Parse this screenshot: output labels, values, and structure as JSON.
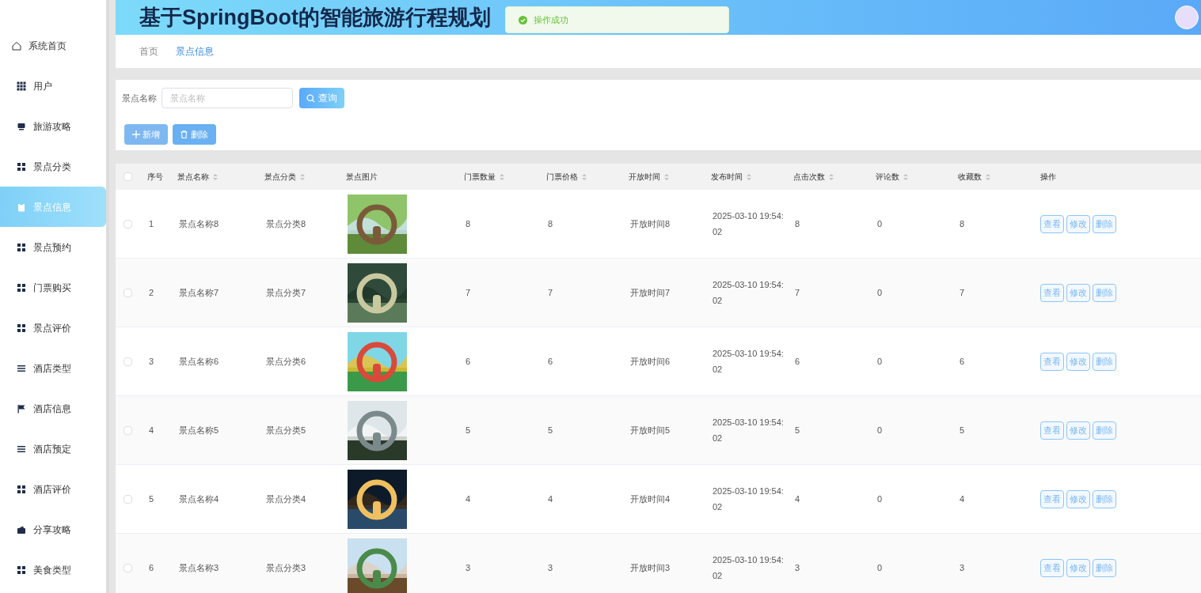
{
  "sidebar": {
    "items": [
      {
        "label": "系统首页",
        "kind": "home",
        "selected": false
      },
      {
        "label": "用户",
        "kind": "grid9",
        "selected": false
      },
      {
        "label": "旅游攻略",
        "kind": "monitor",
        "selected": false
      },
      {
        "label": "景点分类",
        "kind": "grid4",
        "selected": false
      },
      {
        "label": "景点信息",
        "kind": "clipboard",
        "selected": true
      },
      {
        "label": "景点预约",
        "kind": "grid4",
        "selected": false
      },
      {
        "label": "门票购买",
        "kind": "grid4",
        "selected": false
      },
      {
        "label": "景点评价",
        "kind": "grid4",
        "selected": false
      },
      {
        "label": "酒店类型",
        "kind": "list",
        "selected": false
      },
      {
        "label": "酒店信息",
        "kind": "flag",
        "selected": false
      },
      {
        "label": "酒店预定",
        "kind": "list",
        "selected": false
      },
      {
        "label": "酒店评价",
        "kind": "grid4",
        "selected": false
      },
      {
        "label": "分享攻略",
        "kind": "wallet",
        "selected": false
      },
      {
        "label": "美食类型",
        "kind": "grid4",
        "selected": false
      }
    ]
  },
  "header": {
    "title": "基于SpringBoot的智能旅游行程规划"
  },
  "toast": {
    "message": "操作成功"
  },
  "breadcrumb": [
    {
      "label": "首页",
      "selected": false
    },
    {
      "label": "景点信息",
      "selected": true
    }
  ],
  "search": {
    "label": "景点名称",
    "placeholder": "景点名称",
    "button": "查询"
  },
  "actions": {
    "add": "新增",
    "delete": "删除"
  },
  "table": {
    "all_checked": false,
    "columns": [
      {
        "label": "序号",
        "sortable": false
      },
      {
        "label": "景点名称",
        "sortable": true
      },
      {
        "label": "景点分类",
        "sortable": true
      },
      {
        "label": "景点图片",
        "sortable": false
      },
      {
        "label": "门票数量",
        "sortable": true
      },
      {
        "label": "门票价格",
        "sortable": true
      },
      {
        "label": "开放时间",
        "sortable": true
      },
      {
        "label": "发布时间",
        "sortable": true
      },
      {
        "label": "点击次数",
        "sortable": true
      },
      {
        "label": "评论数",
        "sortable": true
      },
      {
        "label": "收藏数",
        "sortable": true
      },
      {
        "label": "操作",
        "sortable": false
      }
    ],
    "rows": [
      {
        "cells": [
          "1",
          "景点名称8",
          "景点分类8",
          "",
          "8",
          "8",
          "开放时间8",
          "2025-03-10 19:54:02",
          "8",
          "0",
          "8"
        ],
        "buttons": [
          "查看",
          "修改",
          "删除"
        ],
        "checked": false
      },
      {
        "cells": [
          "2",
          "景点名称7",
          "景点分类7",
          "",
          "7",
          "7",
          "开放时间7",
          "2025-03-10 19:54:02",
          "7",
          "0",
          "7"
        ],
        "buttons": [
          "查看",
          "修改",
          "删除"
        ],
        "checked": false
      },
      {
        "cells": [
          "3",
          "景点名称6",
          "景点分类6",
          "",
          "6",
          "6",
          "开放时间6",
          "2025-03-10 19:54:02",
          "6",
          "0",
          "6"
        ],
        "buttons": [
          "查看",
          "修改",
          "删除"
        ],
        "checked": false
      },
      {
        "cells": [
          "4",
          "景点名称5",
          "景点分类5",
          "",
          "5",
          "5",
          "开放时间5",
          "2025-03-10 19:54:02",
          "5",
          "0",
          "5"
        ],
        "buttons": [
          "查看",
          "修改",
          "删除"
        ],
        "checked": false
      },
      {
        "cells": [
          "5",
          "景点名称4",
          "景点分类4",
          "",
          "4",
          "4",
          "开放时间4",
          "2025-03-10 19:54:02",
          "4",
          "0",
          "4"
        ],
        "buttons": [
          "查看",
          "修改",
          "删除"
        ],
        "checked": false
      },
      {
        "cells": [
          "6",
          "景点名称3",
          "景点分类3",
          "",
          "3",
          "3",
          "开放时间3",
          "2025-03-10 19:54:02",
          "3",
          "0",
          "3"
        ],
        "buttons": [
          "查看",
          "修改",
          "删除"
        ],
        "checked": false
      }
    ]
  }
}
